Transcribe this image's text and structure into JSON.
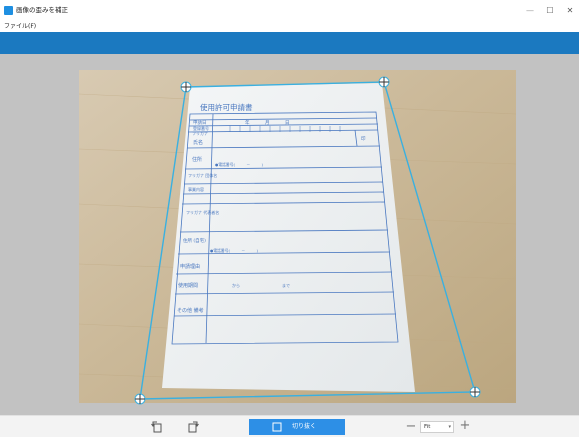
{
  "window": {
    "title": "画像の歪みを補正",
    "minimize_glyph": "—",
    "maximize_glyph": "☐",
    "close_glyph": "✕"
  },
  "menu": {
    "items": [
      {
        "label": "ファイル(F)"
      }
    ]
  },
  "toolbar": {
    "rotate_left_icon": "rotate-left-icon",
    "rotate_right_icon": "rotate-right-icon",
    "crop_label": "切り抜く",
    "zoom_minus": "−",
    "zoom_value": "Fit",
    "zoom_plus": "+"
  },
  "document": {
    "title": "使用許可申請書",
    "header_cells": [
      "申請日",
      "年",
      "月",
      "日",
      "登録番号",
      "フリガナ",
      "氏名",
      "印"
    ],
    "row_labels": [
      "住所",
      "フリガナ 団体名",
      "事業内容",
      "フリガナ 代表者名",
      "住所 (自宅)",
      "申請理由",
      "使用期間",
      "その他 備考"
    ],
    "phone_text": "●電話番号(　　　－　　　)",
    "period_from": "から",
    "period_to": "まで"
  },
  "colors": {
    "accent": "#1b79c0",
    "crop_button": "#2d8fe6",
    "handle_line": "#3ab0e0",
    "form_ink": "#4a78c0"
  }
}
